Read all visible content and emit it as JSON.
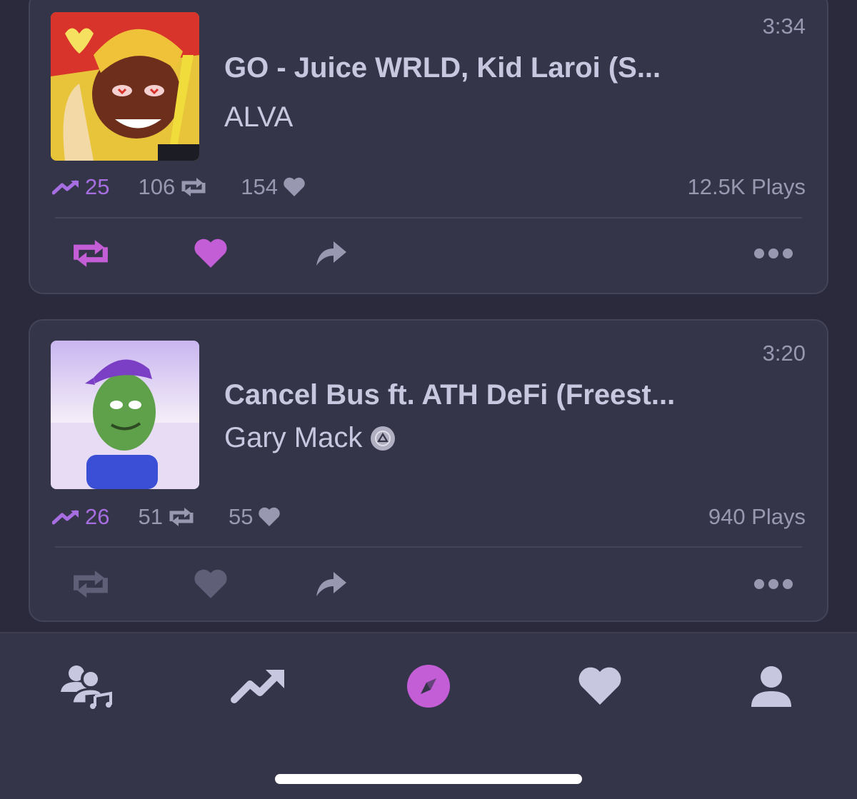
{
  "tracks": [
    {
      "duration": "3:34",
      "title": "GO - Juice WRLD, Kid Laroi (S...",
      "artist": "ALVA",
      "trending": "25",
      "reposts": "106",
      "likes": "154",
      "plays": "12.5K Plays",
      "reposted": true,
      "liked": true
    },
    {
      "duration": "3:20",
      "title": "Cancel Bus ft. ATH DeFi (Freest...",
      "artist": "Gary Mack",
      "trending": "26",
      "reposts": "51",
      "likes": "55",
      "plays": "940 Plays",
      "reposted": false,
      "liked": false
    }
  ],
  "colors": {
    "accent": "#c35ed6",
    "trend": "#a66ee0",
    "muted_icon": "#5f5f78",
    "text": "#c7c7e0",
    "secondary_text": "#9898b0",
    "card": "#35354a",
    "background": "#2a2a3c"
  },
  "tabbar": {
    "tabs": [
      {
        "icon": "feed-users-music-icon",
        "active": false
      },
      {
        "icon": "trending-icon",
        "active": false
      },
      {
        "icon": "explore-compass-icon",
        "active": true
      },
      {
        "icon": "favorites-heart-icon",
        "active": false
      },
      {
        "icon": "profile-user-icon",
        "active": false
      }
    ]
  }
}
